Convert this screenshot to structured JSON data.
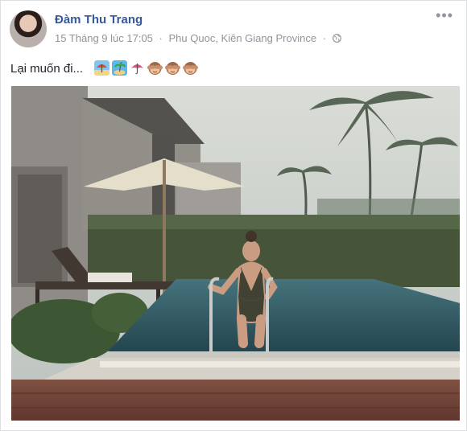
{
  "post": {
    "author": "Đàm Thu Trang",
    "date": "15 Tháng 9 lúc 17:05",
    "location": "Phu Quoc, Kiên Giang Province",
    "separator": "·",
    "caption": "Lại muốn đi...",
    "more_label": "•••",
    "privacy_icon": "globe-icon",
    "emojis": [
      "beach-umbrella-emoji",
      "island-emoji",
      "umbrella-emoji",
      "see-no-evil-monkey-emoji",
      "see-no-evil-monkey-emoji",
      "see-no-evil-monkey-emoji"
    ]
  },
  "colors": {
    "author_link": "#365899",
    "meta_text": "#90949c",
    "body_text": "#1d2129"
  }
}
